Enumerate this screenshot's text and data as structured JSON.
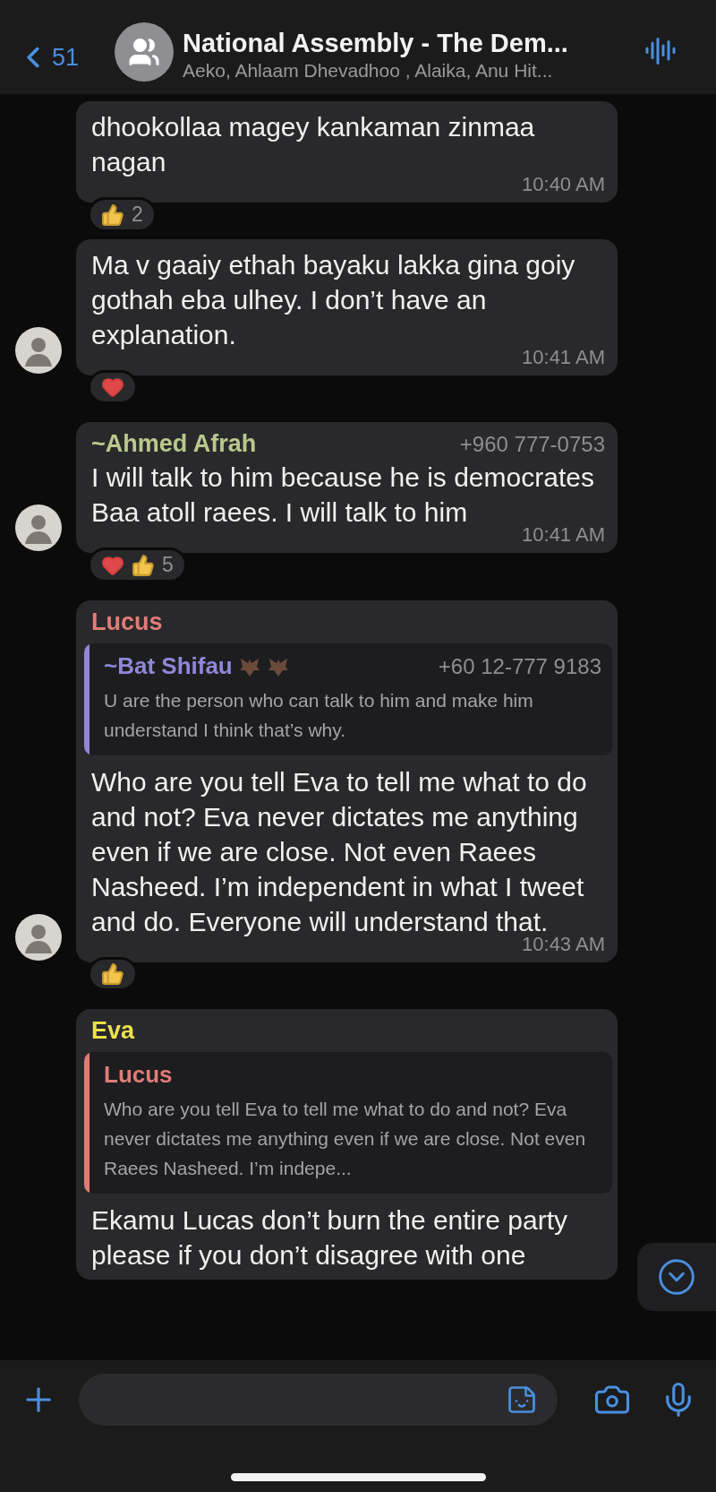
{
  "header": {
    "back_count": "51",
    "title": "National Assembly - The Dem...",
    "subtitle": "Aeko, Ahlaam Dhevadhoo , Alaika, Anu Hit..."
  },
  "messages": [
    {
      "text": "dhookollaa magey kankaman zinmaa nagan",
      "time": "10:40 AM",
      "avatar": false,
      "reactions": [
        {
          "kind": "thumbs-up"
        }
      ],
      "reaction_count": "2"
    },
    {
      "text": "Ma v gaaiy ethah bayaku lakka gina goiy gothah eba ulhey. I don’t have an explanation.",
      "time": "10:41 AM",
      "avatar": true,
      "reactions": [
        {
          "kind": "heart"
        }
      ]
    },
    {
      "sender": {
        "name": "~Ahmed Afrah",
        "phone": "+960 777-0753",
        "color": "#b9c98c"
      },
      "text": "I will talk to him because he is democrates Baa atoll raees. I will talk to him",
      "time": "10:41 AM",
      "avatar": true,
      "reactions": [
        {
          "kind": "heart"
        },
        {
          "kind": "thumbs-up"
        }
      ],
      "reaction_count": "5"
    },
    {
      "sender": {
        "name": "Lucus",
        "color": "#e07c78"
      },
      "quote": {
        "name": "~Bat Shifau",
        "emoji": [
          {
            "kind": "bat"
          },
          {
            "kind": "bat"
          }
        ],
        "phone": "+60 12-777 9183",
        "color": "#8f88d8",
        "text": "U are the person who can talk to him and make him understand I think that’s why."
      },
      "text": "Who are you tell Eva to tell me what to do and not? Eva never dictates me anything even if we are close. Not even Raees Nasheed. I’m independent in what I tweet and do. Everyone will understand that.",
      "time": "10:43 AM",
      "avatar": true,
      "reactions": [
        {
          "kind": "thumbs-up"
        }
      ]
    },
    {
      "sender": {
        "name": "Eva",
        "color": "#ece04e"
      },
      "quote": {
        "name": "Lucus",
        "color": "#e07c78",
        "text": "Who are you tell Eva to tell me what to do and not? Eva never dictates me anything even if we are close. Not even Raees Nasheed. I’m indepe..."
      },
      "text": "Ekamu Lucas don’t burn the entire party please if you don’t disagree with one",
      "avatar": false
    }
  ]
}
